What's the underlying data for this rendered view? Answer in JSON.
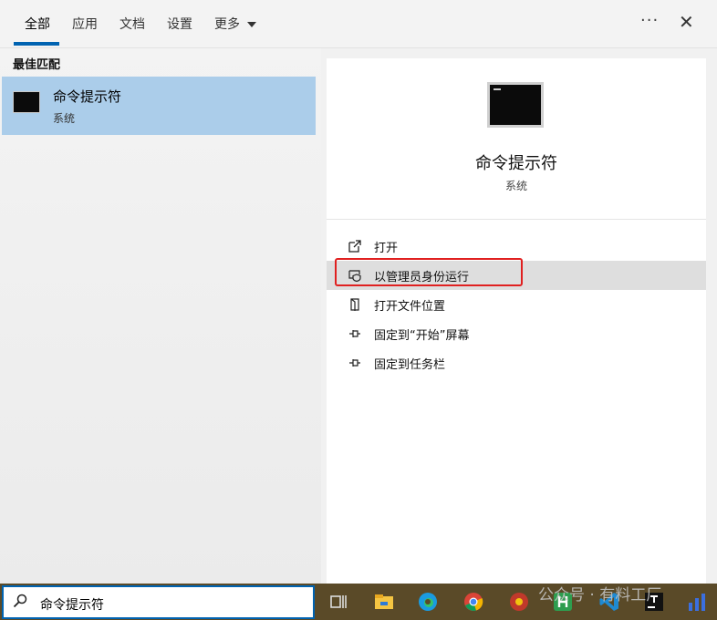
{
  "tabs": [
    {
      "label": "全部",
      "active": true
    },
    {
      "label": "应用"
    },
    {
      "label": "文档"
    },
    {
      "label": "设置"
    },
    {
      "label": "更多"
    }
  ],
  "header": {
    "more_icon": "ellipsis-icon",
    "close_icon": "close-icon"
  },
  "best_match": {
    "heading": "最佳匹配",
    "title": "命令提示符",
    "subtitle": "系统"
  },
  "detail": {
    "title": "命令提示符",
    "subtitle": "系统",
    "actions": [
      {
        "label": "打开",
        "icon": "open-icon"
      },
      {
        "label": "以管理员身份运行",
        "icon": "shield-icon",
        "highlighted": true
      },
      {
        "label": "打开文件位置",
        "icon": "folder-icon"
      },
      {
        "label": "固定到“开始”屏幕",
        "icon": "pin-icon"
      },
      {
        "label": "固定到任务栏",
        "icon": "pin-icon"
      }
    ]
  },
  "search": {
    "value": "命令提示符"
  },
  "watermark": "公众号 · 有料工厂",
  "colors": {
    "accent": "#0063b1",
    "selection": "#abcdea",
    "highlight_box": "#e02020"
  }
}
